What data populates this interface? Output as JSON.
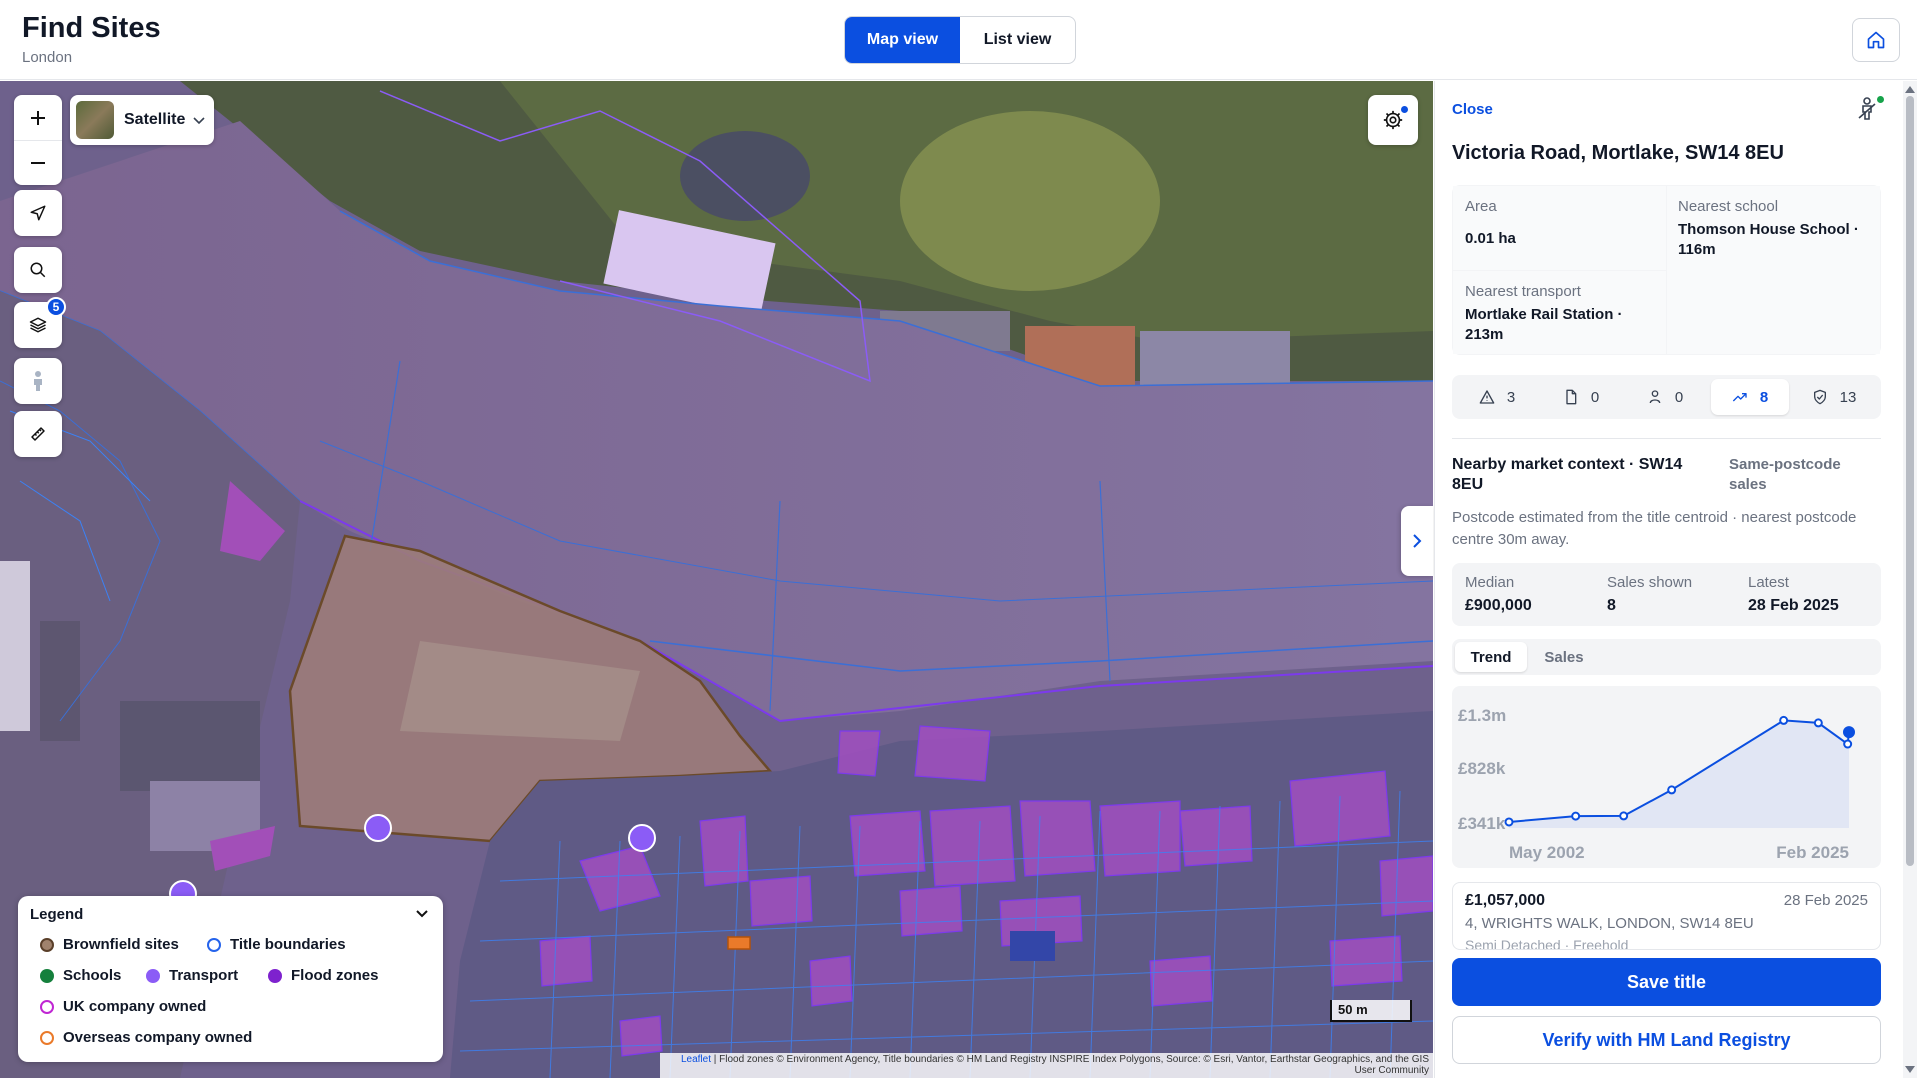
{
  "header": {
    "title": "Find Sites",
    "subtitle": "London",
    "views": [
      {
        "label": "Map view",
        "active": true
      },
      {
        "label": "List view",
        "active": false
      }
    ],
    "home_icon": "home-icon"
  },
  "map": {
    "basemap_label": "Satellite",
    "layers_badge": "5",
    "scale_label": "50 m",
    "attribution_link": "Leaflet",
    "attribution_text": " | Flood zones © Environment Agency, Title boundaries © HM Land Registry INSPIRE Index Polygons, Source: © Esri, Vantor, Earthstar Geographics, and the GIS User Community",
    "legend": {
      "title": "Legend",
      "items": [
        {
          "label": "Brownfield sites",
          "color": "#a0826d"
        },
        {
          "label": "Title boundaries",
          "color": "#2563eb"
        },
        {
          "label": "Schools",
          "color": "#15803d"
        },
        {
          "label": "Transport",
          "color": "#8b5cf6"
        },
        {
          "label": "Flood zones",
          "color": "#7e22ce"
        },
        {
          "label": "UK company owned",
          "color": "#c026d3"
        },
        {
          "label": "Overseas company owned",
          "color": "#ea7a2a"
        }
      ]
    }
  },
  "panel": {
    "close_label": "Close",
    "title": "Victoria Road, Mortlake, SW14 8EU",
    "facts": {
      "area_label": "Area",
      "area_value": "0.01 ha",
      "school_label": "Nearest school",
      "school_value": "Thomson House School · 116m",
      "transport_label": "Nearest transport",
      "transport_value": "Mortlake Rail Station · 213m"
    },
    "metrics": [
      {
        "icon": "warning-icon",
        "value": "3"
      },
      {
        "icon": "document-icon",
        "value": "0"
      },
      {
        "icon": "person-icon",
        "value": "0"
      },
      {
        "icon": "trend-up-icon",
        "value": "8",
        "active": true
      },
      {
        "icon": "shield-check-icon",
        "value": "13"
      }
    ],
    "market": {
      "title": "Nearby market context · SW14 8EU",
      "tag": "Same-postcode sales",
      "note": "Postcode estimated from the title centroid · nearest postcode centre 30m away.",
      "median_label": "Median",
      "median_value": "£900,000",
      "shown_label": "Sales shown",
      "shown_value": "8",
      "latest_label": "Latest",
      "latest_value": "28 Feb 2025"
    },
    "chart_tabs": [
      {
        "label": "Trend",
        "active": true
      },
      {
        "label": "Sales",
        "active": false
      }
    ],
    "sale": {
      "price": "£1,057,000",
      "date": "28 Feb 2025",
      "address": "4, WRIGHTS WALK, LONDON, SW14 8EU",
      "meta": "Semi Detached · Freehold"
    },
    "save_label": "Save title",
    "verify_label": "Verify with HM Land Registry"
  },
  "chart_data": {
    "type": "line",
    "title": "",
    "xlabel": "",
    "ylabel": "",
    "y_tick_labels": [
      "£1.3m",
      "£828k",
      "£341k"
    ],
    "y_ticks": [
      1300000,
      828000,
      341000
    ],
    "x_tick_labels": [
      "May 2002",
      "Feb 2025"
    ],
    "ylim": [
      341000,
      1300000
    ],
    "x": [
      2002.4,
      2007.4,
      2011.0,
      2014.6,
      2023.0,
      2025.6,
      2027.8,
      2027.9
    ],
    "x_range": [
      2002.4,
      2027.9
    ],
    "values": [
      350000,
      402000,
      404000,
      635000,
      1252000,
      1230000,
      1042000,
      1148000
    ],
    "highlight_index": 7,
    "color": "#0b4fe0"
  }
}
